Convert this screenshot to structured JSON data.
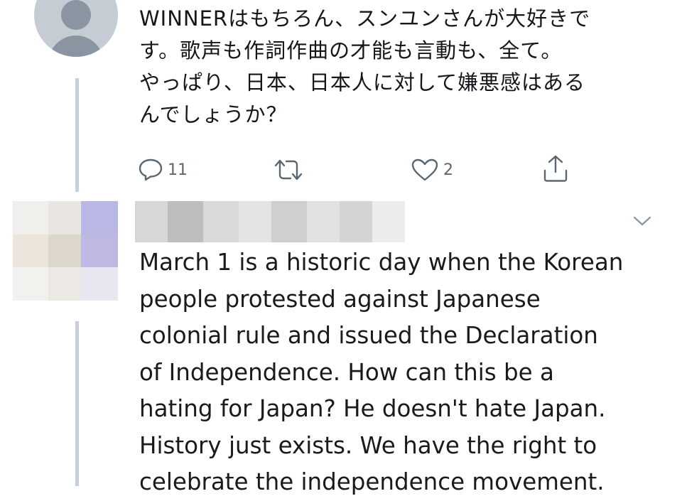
{
  "tweet": {
    "lines": [
      "WINNERはもちろん、スンユンさんが大好きで",
      "す。歌声も作詞作曲の才能も言動も、全て。",
      "やっぱり、日本、日本人に対して嫌悪感はある",
      "んでしょうか？"
    ],
    "reply_count": "11",
    "retweet_count": "",
    "like_count": "2"
  },
  "reply": {
    "lines": [
      "March 1 is a historic day when the Korean",
      "people protested against Japanese",
      "colonial rule and issued the Declaration",
      "of Independence. How can this be a",
      "hating for Japan? He doesn't hate Japan.",
      "History just exists. We have the right to",
      "celebrate the independence movement."
    ]
  },
  "icons": {
    "reply": "reply-icon",
    "retweet": "retweet-icon",
    "like": "heart-icon",
    "share": "share-icon",
    "more": "chevron-down-icon",
    "avatar": "default-avatar-icon"
  },
  "colors": {
    "icon_gray": "#5b6670",
    "thread_line": "#c9d0d7",
    "avatar_bg": "#c5ccd4"
  }
}
